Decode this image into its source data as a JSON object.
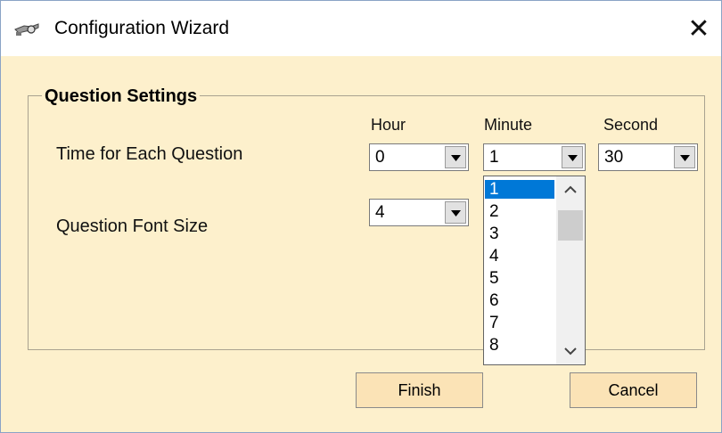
{
  "window": {
    "title": "Configuration Wizard",
    "close_glyph": "✕"
  },
  "group": {
    "title": "Question Settings"
  },
  "columns": {
    "hour": "Hour",
    "minute": "Minute",
    "second": "Second"
  },
  "rows": {
    "time_label": "Time for Each Question",
    "font_label": "Question Font Size"
  },
  "fields": {
    "hour": "0",
    "minute": "1",
    "second": "30",
    "font_size": "4"
  },
  "minute_dropdown": {
    "options": [
      "1",
      "2",
      "3",
      "4",
      "5",
      "6",
      "7",
      "8"
    ],
    "selected": "1"
  },
  "buttons": {
    "finish": "Finish",
    "cancel": "Cancel"
  },
  "colors": {
    "dialog_bg": "#fdf0cc",
    "button_bg": "#fbe3b6",
    "selection": "#0078d7"
  },
  "icons": {
    "app": "key-glasses-icon",
    "close": "close-icon",
    "dropdown": "chevron-down-icon"
  }
}
